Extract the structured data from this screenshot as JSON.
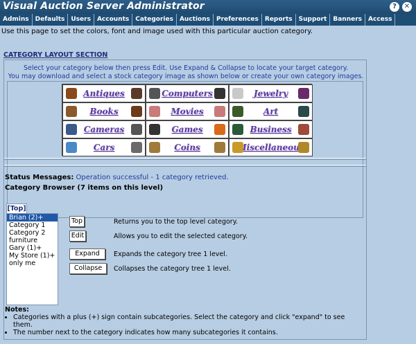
{
  "window": {
    "title": "Visual Auction Server Administrator",
    "help_glyph": "?",
    "close_glyph": "✕"
  },
  "nav": [
    "Admins",
    "Defaults",
    "Users",
    "Accounts",
    "Categories",
    "Auctions",
    "Preferences",
    "Reports",
    "Support",
    "Banners",
    "Access"
  ],
  "intro": "Use this page to set the colors, font and image used with this particular auction category.",
  "section_title": "CATEGORY LAYOUT SECTION",
  "select_msg_1": "Select your category below then press Edit. Use Expand & Collapse to locate your target category.",
  "select_msg_2": "You may download and select a stock category image as shown below or create your own category images.",
  "category_images": [
    {
      "label": "Antiques",
      "left_icon": "chest-icon",
      "right_icon": "lamp-icon",
      "lcolor": "#8a4a1e",
      "rcolor": "#5a3a2a"
    },
    {
      "label": "Computers",
      "left_icon": "monitor-icon",
      "right_icon": "keyboard-icon",
      "lcolor": "#555555",
      "rcolor": "#333333"
    },
    {
      "label": "Jewelry",
      "left_icon": "ring-icon",
      "right_icon": "gem-icon",
      "lcolor": "#c9c9c9",
      "rcolor": "#6a2a6a"
    },
    {
      "label": "Books",
      "left_icon": "book-icon",
      "right_icon": "open-book-icon",
      "lcolor": "#8a5a2a",
      "rcolor": "#6a3a1a"
    },
    {
      "label": "Movies",
      "left_icon": "star-icon",
      "right_icon": "star-icon",
      "lcolor": "#c97a7a",
      "rcolor": "#c97a7a"
    },
    {
      "label": "Art",
      "left_icon": "painting-icon",
      "right_icon": "statue-icon",
      "lcolor": "#3a5a2a",
      "rcolor": "#2a4a4a"
    },
    {
      "label": "Cameras",
      "left_icon": "camera-icon",
      "right_icon": "tripod-icon",
      "lcolor": "#3a5a8a",
      "rcolor": "#555555"
    },
    {
      "label": "Games",
      "left_icon": "piano-icon",
      "right_icon": "ball-icon",
      "lcolor": "#333333",
      "rcolor": "#d86a1a"
    },
    {
      "label": "Business",
      "left_icon": "briefcase-icon",
      "right_icon": "person-icon",
      "lcolor": "#2a5a3a",
      "rcolor": "#a04a3a"
    },
    {
      "label": "Cars",
      "left_icon": "car-icon",
      "right_icon": "truck-icon",
      "lcolor": "#4a8ac9",
      "rcolor": "#6a6a6a"
    },
    {
      "label": "Coins",
      "left_icon": "coin-icon",
      "right_icon": "coin-icon",
      "lcolor": "#a07a3a",
      "rcolor": "#a07a3a"
    },
    {
      "label": "Miscellaneous",
      "left_icon": "gift-icon",
      "right_icon": "gears-icon",
      "lcolor": "#c99a2a",
      "rcolor": "#b0882a"
    }
  ],
  "status": {
    "label": "Status Messages:",
    "message": "Operation successful - 1 category retrieved."
  },
  "browser": {
    "title": "Category Browser (7 items on this level)",
    "top_tab": "[Top]",
    "items": [
      "Brian (2)+",
      "Category 1",
      "Category 2",
      "furniture",
      "Gary (1)+",
      "My Store (1)+",
      "only me"
    ],
    "selected_index": 0
  },
  "buttons": {
    "top": {
      "label": "Top",
      "desc": "Returns you to the top level category."
    },
    "edit": {
      "label": "Edit",
      "desc": "Allows you to edit the selected category."
    },
    "expand": {
      "label": "Expand",
      "desc": "Expands the category tree 1 level."
    },
    "collapse": {
      "label": "Collapse",
      "desc": "Collapses the category tree 1 level."
    }
  },
  "notes": {
    "title": "Notes:",
    "items": [
      "Categories with a plus (+) sign contain subcategories. Select the category and click \"expand\" to see them.",
      "The number next to the category indicates how many subcategories it contains."
    ]
  }
}
